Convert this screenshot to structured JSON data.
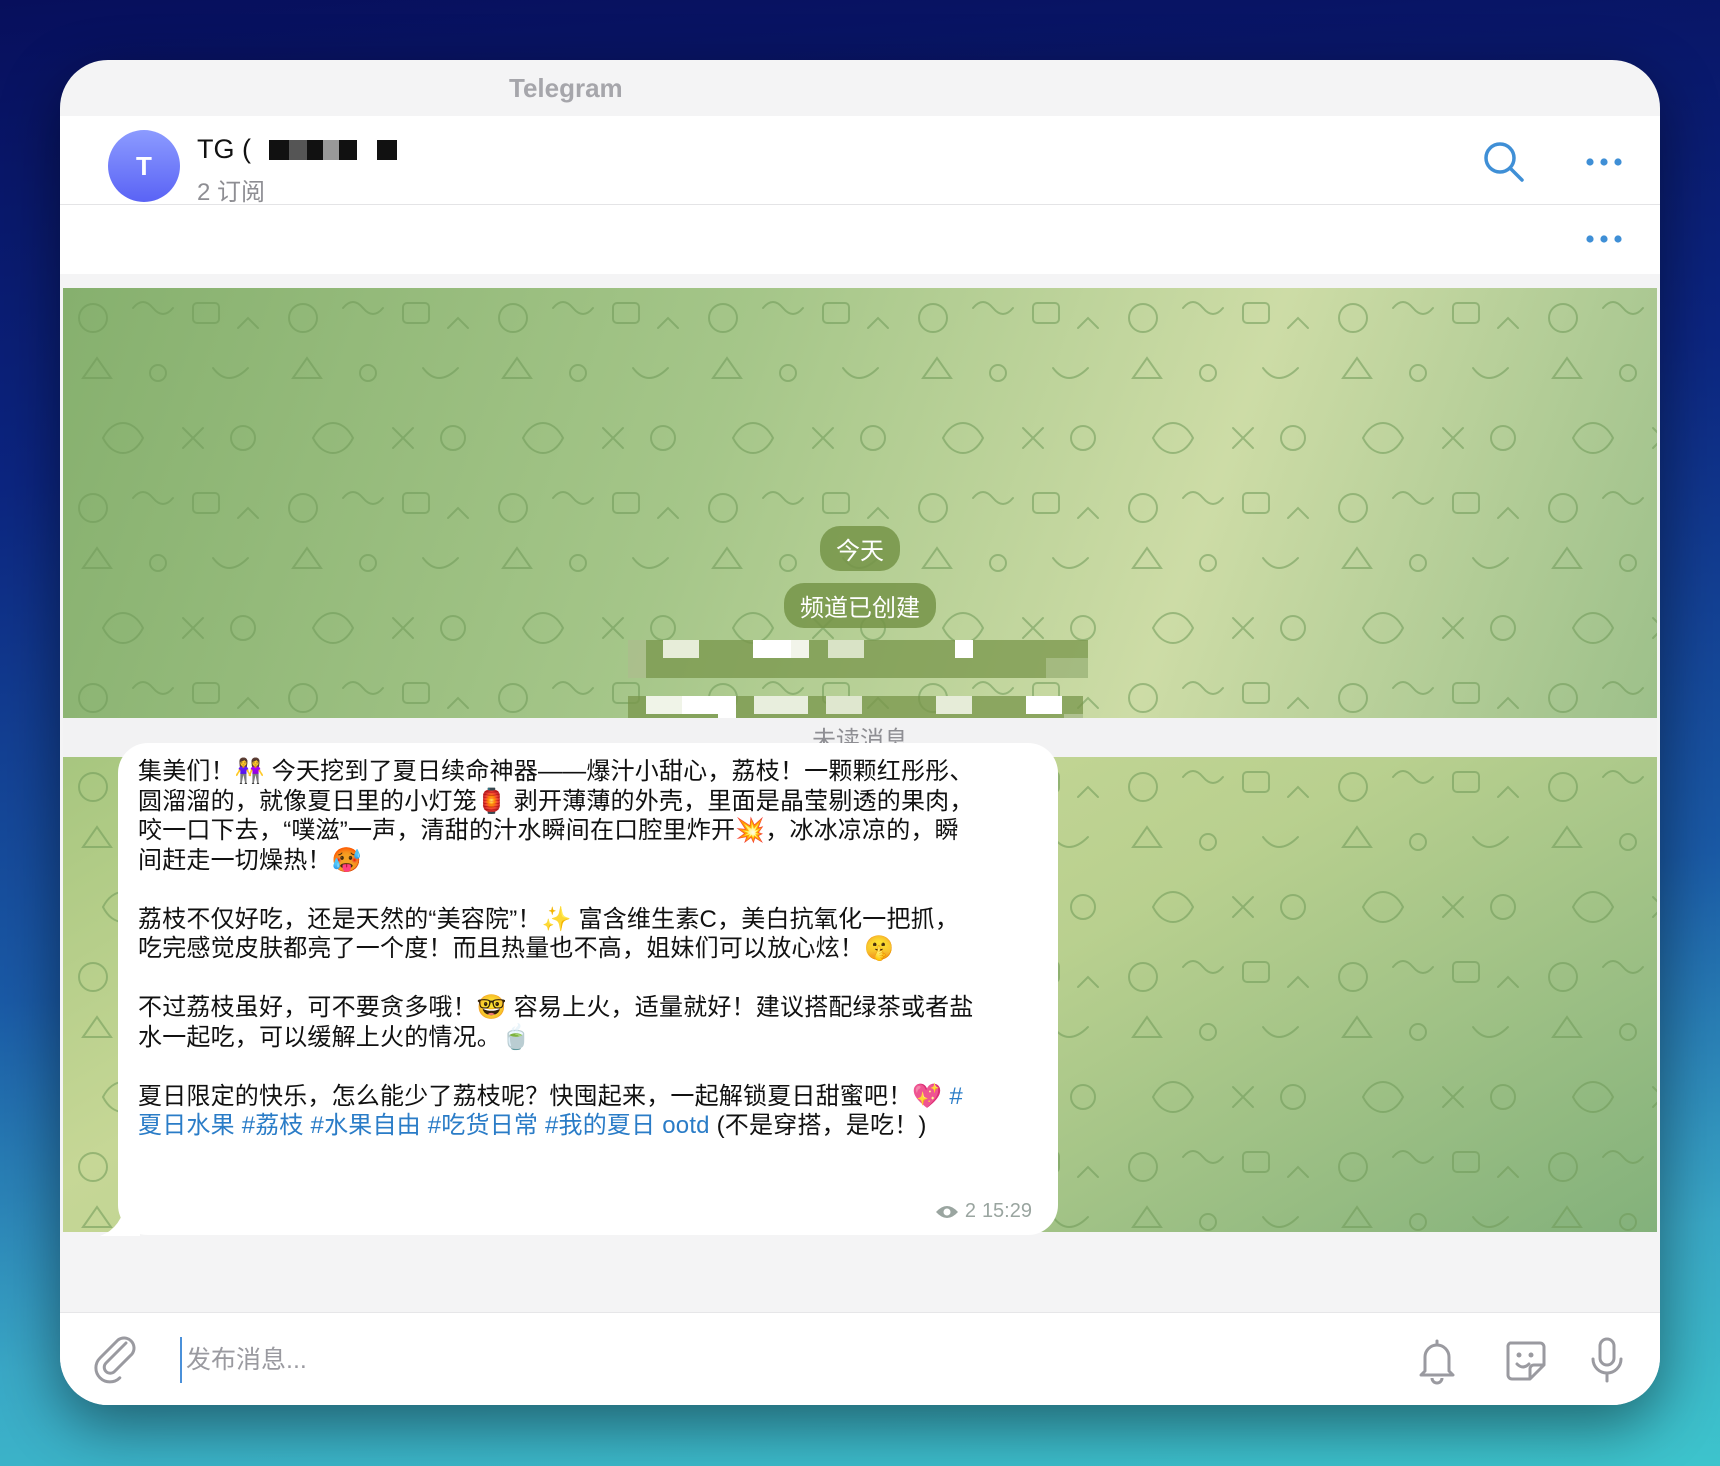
{
  "window": {
    "title": "Telegram"
  },
  "header": {
    "avatar_letter": "T",
    "channel_name": "TG (",
    "subscribers": "2 订阅"
  },
  "chat": {
    "date_pill": "今天",
    "service_pill": "频道已创建",
    "unread_divider": "未读消息",
    "message": {
      "paragraph1": "集美们！👭 今天挖到了夏日续命神器——爆汁小甜心，荔枝！一颗颗红彤彤、\n圆溜溜的，就像夏日里的小灯笼🏮 剥开薄薄的外壳，里面是晶莹剔透的果肉，\n咬一口下去，“噗滋”一声，清甜的汁水瞬间在口腔里炸开💥，冰冰凉凉的，瞬\n间赶走一切燥热！🥵",
      "paragraph2": "荔枝不仅好吃，还是天然的“美容院”！✨ 富含维生素C，美白抗氧化一把抓，\n吃完感觉皮肤都亮了一个度！而且热量也不高，姐妹们可以放心炫！🤫",
      "paragraph3": "不过荔枝虽好，可不要贪多哦！🤓 容易上火，适量就好！建议搭配绿茶或者盐\n水一起吃，可以缓解上火的情况。🍵",
      "paragraph4_text": "夏日限定的快乐，怎么能少了荔枝呢？快囤起来，一起解锁夏日甜蜜吧！💖 ",
      "hashtags": [
        "#\n夏日水果",
        "#荔枝",
        "#水果自由",
        "#吃货日常",
        "#我的夏日"
      ],
      "tail_tag": "ootd",
      "tail_text": " (不是穿搭，是吃！)",
      "views": "2",
      "time": "15:29"
    }
  },
  "input": {
    "placeholder": "发布消息..."
  },
  "icons": {
    "search": "search-icon",
    "more": "more-icon",
    "attach": "paperclip-icon",
    "bell": "bell-icon",
    "sticker": "sticker-icon",
    "mic": "microphone-icon",
    "eye": "eye-icon"
  },
  "colors": {
    "accent": "#2a7cc7",
    "avatar_top": "#8c9bff",
    "avatar_bottom": "#5a63f5",
    "pill_bg": "#769448"
  }
}
